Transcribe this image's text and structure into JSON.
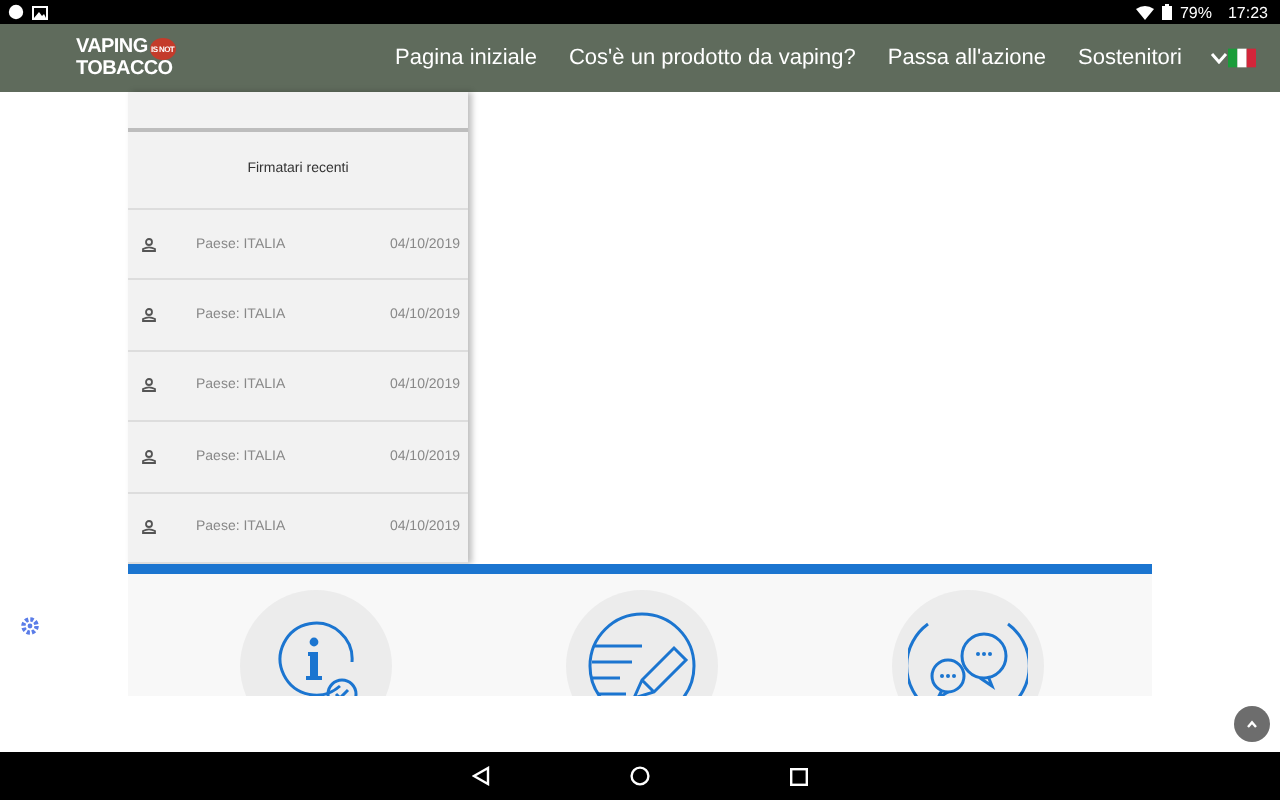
{
  "status_bar": {
    "battery": "79%",
    "time": "17:23"
  },
  "header": {
    "logo": {
      "line_1": "VAPING",
      "badge": "IS NOT",
      "line_2": "TOBACCO"
    },
    "menu": [
      {
        "label": "Pagina iniziale"
      },
      {
        "label": "Cos'è un prodotto da vaping?"
      },
      {
        "label": "Passa all'azione"
      },
      {
        "label": "Sostenitori"
      }
    ]
  },
  "signers": {
    "title": "Firmatari recenti",
    "rows": [
      {
        "country": "Paese: ITALIA",
        "date": "04/10/2019"
      },
      {
        "country": "Paese: ITALIA",
        "date": "04/10/2019"
      },
      {
        "country": "Paese: ITALIA",
        "date": "04/10/2019"
      },
      {
        "country": "Paese: ITALIA",
        "date": "04/10/2019"
      },
      {
        "country": "Paese: ITALIA",
        "date": "04/10/2019"
      }
    ]
  },
  "features": [
    {
      "kind": "info"
    },
    {
      "kind": "petition"
    },
    {
      "kind": "chat"
    }
  ]
}
